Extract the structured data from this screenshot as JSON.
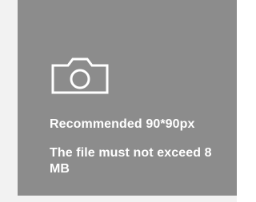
{
  "upload": {
    "icon": "camera-icon",
    "recommendation": "Recommended 90*90px",
    "size_limit": "The file must not exceed 8 MB",
    "colors": {
      "panel_bg": "#8c8c8c",
      "text": "#ffffff",
      "page_bg": "#f2f2f2"
    }
  }
}
